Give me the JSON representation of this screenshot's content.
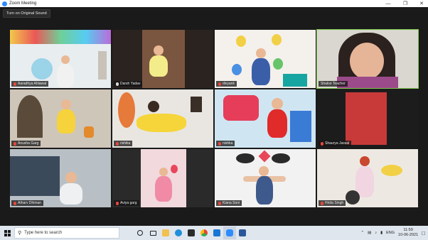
{
  "window": {
    "title": "Zoom Meeting",
    "minimize": "—",
    "maximize": "❐",
    "close": "✕"
  },
  "toolbar": {
    "sound_button": "Turn on Original Sound"
  },
  "participants": [
    {
      "name": "Aaradhya Ahlawat",
      "muted": true
    },
    {
      "name": "Darsh Yadav",
      "muted": false
    },
    {
      "name": "divyank",
      "muted": true
    },
    {
      "name": "Shaloo Teacher",
      "muted": false,
      "active": true
    },
    {
      "name": "Anusha Garg",
      "muted": true
    },
    {
      "name": "rishika",
      "muted": true
    },
    {
      "name": "nishka",
      "muted": true
    },
    {
      "name": "Shaurya Jassal",
      "muted": true
    },
    {
      "name": "Atharv Dhiman",
      "muted": true
    },
    {
      "name": "Aviya garg",
      "muted": true
    },
    {
      "name": "Kiana Soni",
      "muted": true
    },
    {
      "name": "Hrida Singh",
      "muted": true
    }
  ],
  "taskbar": {
    "search_placeholder": "Type here to search",
    "apps": [
      "search",
      "task-view",
      "file-explorer",
      "edge",
      "store",
      "chrome",
      "mail",
      "zoom",
      "word"
    ],
    "tray": {
      "language": "ENG",
      "time": "11:59",
      "date": "10-06-2021"
    }
  },
  "colors": {
    "accent": "#2d8cff",
    "active_speaker": "#7cc64a",
    "muted": "#e8463c"
  }
}
